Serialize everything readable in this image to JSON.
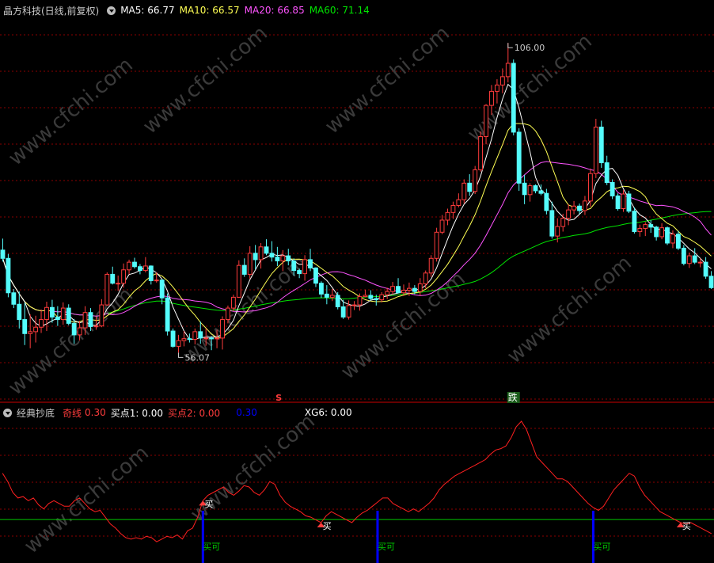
{
  "main_header": {
    "title": "晶方科技(日线,前复权)",
    "ma5_label": "MA5: 66.77",
    "ma10_label": "MA10: 66.57",
    "ma20_label": "MA20: 66.85",
    "ma60_label": "MA60: 71.14"
  },
  "sub_header": {
    "title": "经典抄底",
    "qixian_label": "奇线",
    "qixian_value": "0.30",
    "buy1_label": "买点1: 0.00",
    "buy2_label": "买点2: 0.00",
    "blue_value": "0.30",
    "xg6_label": "XG6: 0.00"
  },
  "colors": {
    "up": "#ff3c3c",
    "down": "#54fcfc",
    "ma5": "#ffffff",
    "ma10": "#ffff54",
    "ma20": "#ff54ff",
    "ma60": "#00e400",
    "grid": "#8b0000",
    "buyline": "#0000ff",
    "zero_line": "#00c800",
    "qixian_line": "#ff2020"
  },
  "annotations": {
    "high_label": "106.00",
    "low_label": "56.07",
    "s_mark": "S",
    "die_mark": "跌",
    "buy_ke": "买可",
    "buy": "买"
  },
  "watermark": "www.cfchi.com",
  "chart_data": [
    {
      "type": "candlestick",
      "title": "晶方科技(日线,前复权)",
      "ylim": [
        50,
        110
      ],
      "high": 106.0,
      "low": 56.07,
      "series": [
        {
          "name": "MA5",
          "last": 66.77
        },
        {
          "name": "MA10",
          "last": 66.57
        },
        {
          "name": "MA20",
          "last": 66.85
        },
        {
          "name": "MA60",
          "last": 71.14
        }
      ],
      "ohlc": [
        [
          73.5,
          75.3,
          71.7,
          72.2
        ],
        [
          72.2,
          72.9,
          66.1,
          66.8
        ],
        [
          66.8,
          67.4,
          64.4,
          65.0
        ],
        [
          65.0,
          67.0,
          61.2,
          62.6
        ],
        [
          62.6,
          65.2,
          58.6,
          60.4
        ],
        [
          60.4,
          63.4,
          58.1,
          60.7
        ],
        [
          60.7,
          63.2,
          59.0,
          61.4
        ],
        [
          61.4,
          64.2,
          60.5,
          62.6
        ],
        [
          62.6,
          65.4,
          60.8,
          64.5
        ],
        [
          64.5,
          65.7,
          62.1,
          63.0
        ],
        [
          63.0,
          64.7,
          61.6,
          62.6
        ],
        [
          62.6,
          65.3,
          61.8,
          64.4
        ],
        [
          64.4,
          65.0,
          61.7,
          62.0
        ],
        [
          62.0,
          62.7,
          58.8,
          60.2
        ],
        [
          60.2,
          62.4,
          59.3,
          61.3
        ],
        [
          61.3,
          64.7,
          60.2,
          63.7
        ],
        [
          63.7,
          64.4,
          60.8,
          61.5
        ],
        [
          61.5,
          63.1,
          61.0,
          61.6
        ],
        [
          61.6,
          65.8,
          61.4,
          64.9
        ],
        [
          64.9,
          70.0,
          64.8,
          69.7
        ],
        [
          69.7,
          70.9,
          68.1,
          68.3
        ],
        [
          68.3,
          69.5,
          67.1,
          68.3
        ],
        [
          68.3,
          71.4,
          67.6,
          70.4
        ],
        [
          70.4,
          72.0,
          69.7,
          71.6
        ],
        [
          71.6,
          72.3,
          70.6,
          70.9
        ],
        [
          70.9,
          71.3,
          69.7,
          70.3
        ],
        [
          70.3,
          72.4,
          70.0,
          71.0
        ],
        [
          71.0,
          71.1,
          68.1,
          68.7
        ],
        [
          68.7,
          70.0,
          68.4,
          68.8
        ],
        [
          68.8,
          68.9,
          65.0,
          66.0
        ],
        [
          66.0,
          66.7,
          60.1,
          60.8
        ],
        [
          60.8,
          61.2,
          58.2,
          58.4
        ],
        [
          58.4,
          60.2,
          57.4,
          59.3
        ],
        [
          59.3,
          60.8,
          58.4,
          59.6
        ],
        [
          59.6,
          60.4,
          59.0,
          59.5
        ],
        [
          59.5,
          61.2,
          58.7,
          60.7
        ],
        [
          60.7,
          62.3,
          58.8,
          59.7
        ],
        [
          59.7,
          61.2,
          58.5,
          59.7
        ],
        [
          59.7,
          60.0,
          57.8,
          59.6
        ],
        [
          59.6,
          61.0,
          58.1,
          59.7
        ],
        [
          59.7,
          63.1,
          57.9,
          62.6
        ],
        [
          62.6,
          64.8,
          62.0,
          64.4
        ],
        [
          64.4,
          66.5,
          63.9,
          66.1
        ],
        [
          66.1,
          71.9,
          66.0,
          71.1
        ],
        [
          71.1,
          72.2,
          69.3,
          69.7
        ],
        [
          69.7,
          74.1,
          69.0,
          73.0
        ],
        [
          73.0,
          74.3,
          70.5,
          72.0
        ],
        [
          72.0,
          74.6,
          70.6,
          74.0
        ],
        [
          74.0,
          75.2,
          72.7,
          73.0
        ],
        [
          73.0,
          74.9,
          71.7,
          72.4
        ],
        [
          72.4,
          74.0,
          71.0,
          71.8
        ],
        [
          71.8,
          73.5,
          70.2,
          72.6
        ],
        [
          72.6,
          73.7,
          71.1,
          71.8
        ],
        [
          71.8,
          72.2,
          69.5,
          70.3
        ],
        [
          70.3,
          70.6,
          69.1,
          69.8
        ],
        [
          69.8,
          72.7,
          68.7,
          72.0
        ],
        [
          72.0,
          73.7,
          70.2,
          70.7
        ],
        [
          70.7,
          70.8,
          67.7,
          68.3
        ],
        [
          68.3,
          68.6,
          66.0,
          66.6
        ],
        [
          66.6,
          68.0,
          65.0,
          66.1
        ],
        [
          66.1,
          67.4,
          65.5,
          66.4
        ],
        [
          66.4,
          66.9,
          64.2,
          64.6
        ],
        [
          64.6,
          65.7,
          62.7,
          63.0
        ],
        [
          63.0,
          65.6,
          62.6,
          64.8
        ],
        [
          64.8,
          65.5,
          64.1,
          64.9
        ],
        [
          64.9,
          66.7,
          64.0,
          66.2
        ],
        [
          66.2,
          67.3,
          66.1,
          66.4
        ],
        [
          66.4,
          67.2,
          65.6,
          65.9
        ],
        [
          65.9,
          66.5,
          64.8,
          65.7
        ],
        [
          65.7,
          66.9,
          65.3,
          66.5
        ],
        [
          66.5,
          67.6,
          65.8,
          67.0
        ],
        [
          67.0,
          68.5,
          66.5,
          67.8
        ],
        [
          67.8,
          69.1,
          66.7,
          66.8
        ],
        [
          66.8,
          68.1,
          66.3,
          67.2
        ],
        [
          67.2,
          68.4,
          66.3,
          67.5
        ],
        [
          67.5,
          68.0,
          66.6,
          67.0
        ],
        [
          67.0,
          69.1,
          66.3,
          68.2
        ],
        [
          68.2,
          70.3,
          67.5,
          69.9
        ],
        [
          69.9,
          72.7,
          69.3,
          72.2
        ],
        [
          72.2,
          77.0,
          71.7,
          76.3
        ],
        [
          76.3,
          79.0,
          76.0,
          78.2
        ],
        [
          78.2,
          80.0,
          77.4,
          79.4
        ],
        [
          79.4,
          81.1,
          78.4,
          80.5
        ],
        [
          80.5,
          82.4,
          80.2,
          81.4
        ],
        [
          81.4,
          84.6,
          80.8,
          84.0
        ],
        [
          84.0,
          85.4,
          82.0,
          82.7
        ],
        [
          82.7,
          86.7,
          82.3,
          86.1
        ],
        [
          86.1,
          92.1,
          85.8,
          91.3
        ],
        [
          91.3,
          96.4,
          90.1,
          96.2
        ],
        [
          96.2,
          99.4,
          94.7,
          98.4
        ],
        [
          98.4,
          100.3,
          96.5,
          99.4
        ],
        [
          99.4,
          102.0,
          98.1,
          100.7
        ],
        [
          100.7,
          106.0,
          99.8,
          102.8
        ],
        [
          102.8,
          103.4,
          91.5,
          92.0
        ],
        [
          92.0,
          92.6,
          82.8,
          84.0
        ],
        [
          84.0,
          85.3,
          80.7,
          82.2
        ],
        [
          82.2,
          84.0,
          81.1,
          83.6
        ],
        [
          83.6,
          83.8,
          82.4,
          82.8
        ],
        [
          82.8,
          83.8,
          82.1,
          82.4
        ],
        [
          82.4,
          83.1,
          79.1,
          79.7
        ],
        [
          79.7,
          81.1,
          75.3,
          75.7
        ],
        [
          75.7,
          78.5,
          74.7,
          77.2
        ],
        [
          77.2,
          79.2,
          76.4,
          78.5
        ],
        [
          78.5,
          80.7,
          77.4,
          79.8
        ],
        [
          79.8,
          81.2,
          79.1,
          80.4
        ],
        [
          80.4,
          80.8,
          79.2,
          79.7
        ],
        [
          79.7,
          82.0,
          79.0,
          81.2
        ],
        [
          81.2,
          86.3,
          80.3,
          85.5
        ],
        [
          85.5,
          94.1,
          84.8,
          92.8
        ],
        [
          92.8,
          93.8,
          86.4,
          87.2
        ],
        [
          87.2,
          88.3,
          83.7,
          84.1
        ],
        [
          84.1,
          84.6,
          81.5,
          82.0
        ],
        [
          82.0,
          82.4,
          79.7,
          80.0
        ],
        [
          80.0,
          82.9,
          79.5,
          82.3
        ],
        [
          82.3,
          82.8,
          79.3,
          79.6
        ],
        [
          79.6,
          80.2,
          76.1,
          76.4
        ],
        [
          76.4,
          77.5,
          75.6,
          76.9
        ],
        [
          76.9,
          77.9,
          75.7,
          77.5
        ],
        [
          77.5,
          78.2,
          76.2,
          77.1
        ],
        [
          77.1,
          77.3,
          75.0,
          75.6
        ],
        [
          75.6,
          77.7,
          75.2,
          77.0
        ],
        [
          77.0,
          77.2,
          74.3,
          74.6
        ],
        [
          74.6,
          76.6,
          73.8,
          76.0
        ],
        [
          76.0,
          76.5,
          73.5,
          73.8
        ],
        [
          73.8,
          74.3,
          71.1,
          71.4
        ],
        [
          71.4,
          73.1,
          70.7,
          72.6
        ],
        [
          72.6,
          73.8,
          71.3,
          71.6
        ],
        [
          71.6,
          72.2,
          70.8,
          71.6
        ],
        [
          71.6,
          72.4,
          69.0,
          69.4
        ],
        [
          69.4,
          70.2,
          67.4,
          67.6
        ]
      ]
    },
    {
      "type": "line",
      "title": "经典抄底",
      "series": [
        {
          "name": "奇线",
          "last": 0.3
        },
        {
          "name": "买点1",
          "last": 0.0
        },
        {
          "name": "买点2",
          "last": 0.0
        },
        {
          "name": "XG6",
          "last": 0.0
        }
      ],
      "qixian": [
        0.62,
        0.56,
        0.48,
        0.44,
        0.45,
        0.42,
        0.44,
        0.39,
        0.36,
        0.4,
        0.42,
        0.4,
        0.38,
        0.38,
        0.42,
        0.44,
        0.4,
        0.36,
        0.34,
        0.35,
        0.3,
        0.25,
        0.22,
        0.18,
        0.15,
        0.14,
        0.15,
        0.14,
        0.16,
        0.15,
        0.12,
        0.14,
        0.16,
        0.15,
        0.17,
        0.14,
        0.2,
        0.22,
        0.3,
        0.42,
        0.46,
        0.48,
        0.5,
        0.52,
        0.48,
        0.46,
        0.49,
        0.53,
        0.52,
        0.48,
        0.46,
        0.5,
        0.56,
        0.54,
        0.46,
        0.41,
        0.38,
        0.36,
        0.34,
        0.31,
        0.3,
        0.28,
        0.26,
        0.31,
        0.34,
        0.32,
        0.3,
        0.28,
        0.26,
        0.3,
        0.33,
        0.35,
        0.38,
        0.41,
        0.44,
        0.44,
        0.4,
        0.38,
        0.36,
        0.34,
        0.36,
        0.34,
        0.37,
        0.4,
        0.44,
        0.5,
        0.54,
        0.57,
        0.6,
        0.62,
        0.64,
        0.66,
        0.68,
        0.7,
        0.72,
        0.76,
        0.79,
        0.8,
        0.82,
        0.88,
        0.96,
        1.0,
        0.94,
        0.84,
        0.74,
        0.7,
        0.66,
        0.62,
        0.58,
        0.58,
        0.56,
        0.52,
        0.48,
        0.44,
        0.4,
        0.37,
        0.35,
        0.38,
        0.44,
        0.5,
        0.54,
        0.58,
        0.62,
        0.6,
        0.52,
        0.46,
        0.42,
        0.38,
        0.34,
        0.32,
        0.3,
        0.28,
        0.26,
        0.25,
        0.26,
        0.24,
        0.22,
        0.2,
        0.18
      ],
      "buy_ke_positions": [
        39,
        73,
        115
      ],
      "buy_positions": [
        39,
        62,
        132
      ]
    }
  ]
}
